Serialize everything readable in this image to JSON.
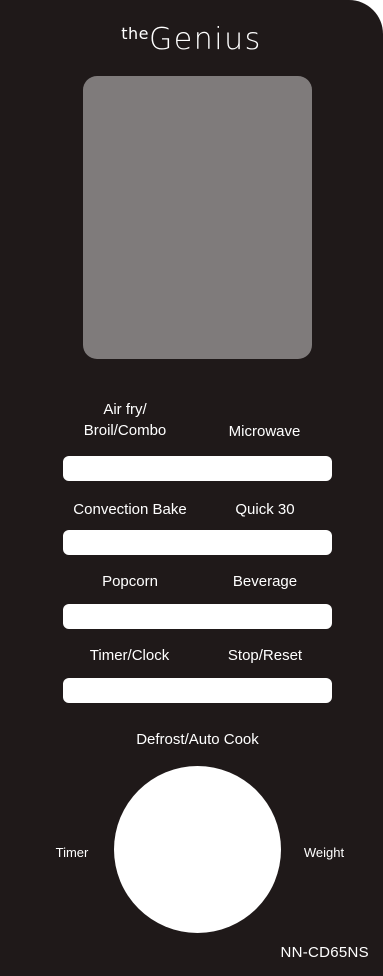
{
  "brand": {
    "prefix": "the",
    "name": "Genius"
  },
  "buttons": {
    "air_fry": "Air fry/\nBroil/Combo",
    "microwave": "Microwave",
    "convection_bake": "Convection Bake",
    "quick_30": "Quick 30",
    "popcorn": "Popcorn",
    "beverage": "Beverage",
    "timer_clock": "Timer/Clock",
    "stop_reset": "Stop/Reset"
  },
  "dial": {
    "top_label": "Defrost/Auto Cook",
    "left_label": "Timer",
    "right_label": "Weight"
  },
  "model": "NN-CD65NS",
  "colors": {
    "panel": "#1f1919",
    "display": "#7f7b7b",
    "buttons": "#ffffff"
  }
}
